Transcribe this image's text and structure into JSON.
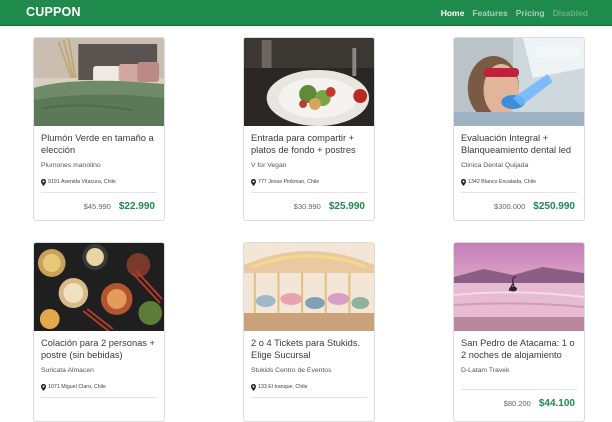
{
  "navbar": {
    "brand": "CUPPON",
    "links": [
      {
        "label": "Home"
      },
      {
        "label": "Features"
      },
      {
        "label": "Pricing"
      },
      {
        "label": "Disabled"
      }
    ]
  },
  "colors": {
    "brand_green": "#1e8a4c",
    "price_green": "#1e8a4c"
  },
  "cards": [
    {
      "title": "Plumón Verde en tamaño a elección",
      "merchant": "Plumones manolino",
      "address": "9191 Avenida Vitacura, Chile",
      "old_price": "$45.990",
      "new_price": "$22.990",
      "image_icon": "bedroom-pillows-image"
    },
    {
      "title": "Entrada para compartir + platos de fondo + postres",
      "merchant": "V for Vegan",
      "address": "777 Jesse Pinkman, Chile",
      "old_price": "$30.990",
      "new_price": "$25.990",
      "image_icon": "salad-dish-image"
    },
    {
      "title": "Evaluación Integral + Blanqueamiento dental led",
      "merchant": "Clinica Dental Quijada",
      "address": "1342 Blanco Encalada, Chile",
      "old_price": "$300.000",
      "new_price": "$250.990",
      "image_icon": "dental-whitening-image"
    },
    {
      "title": "Colación para 2 personas + postre (sin bebidas)",
      "merchant": "Suricata Almacen",
      "address": "1071 Miguel Claro, Chile",
      "old_price": "",
      "new_price": "",
      "image_icon": "asian-food-bowls-image"
    },
    {
      "title": "2 o 4 Tickets para Stukids. Elige Sucursal",
      "merchant": "Stukids Centro de Eventos",
      "address": "133 El tranque, Chile",
      "old_price": "",
      "new_price": "",
      "image_icon": "carousel-image"
    },
    {
      "title": "San Pedro de Atacama: 1 o 2 noches de alojamiento",
      "merchant": "D-Latam Travek",
      "address": "",
      "old_price": "$80.200",
      "new_price": "$44.100",
      "image_icon": "flamingo-lake-image"
    }
  ]
}
